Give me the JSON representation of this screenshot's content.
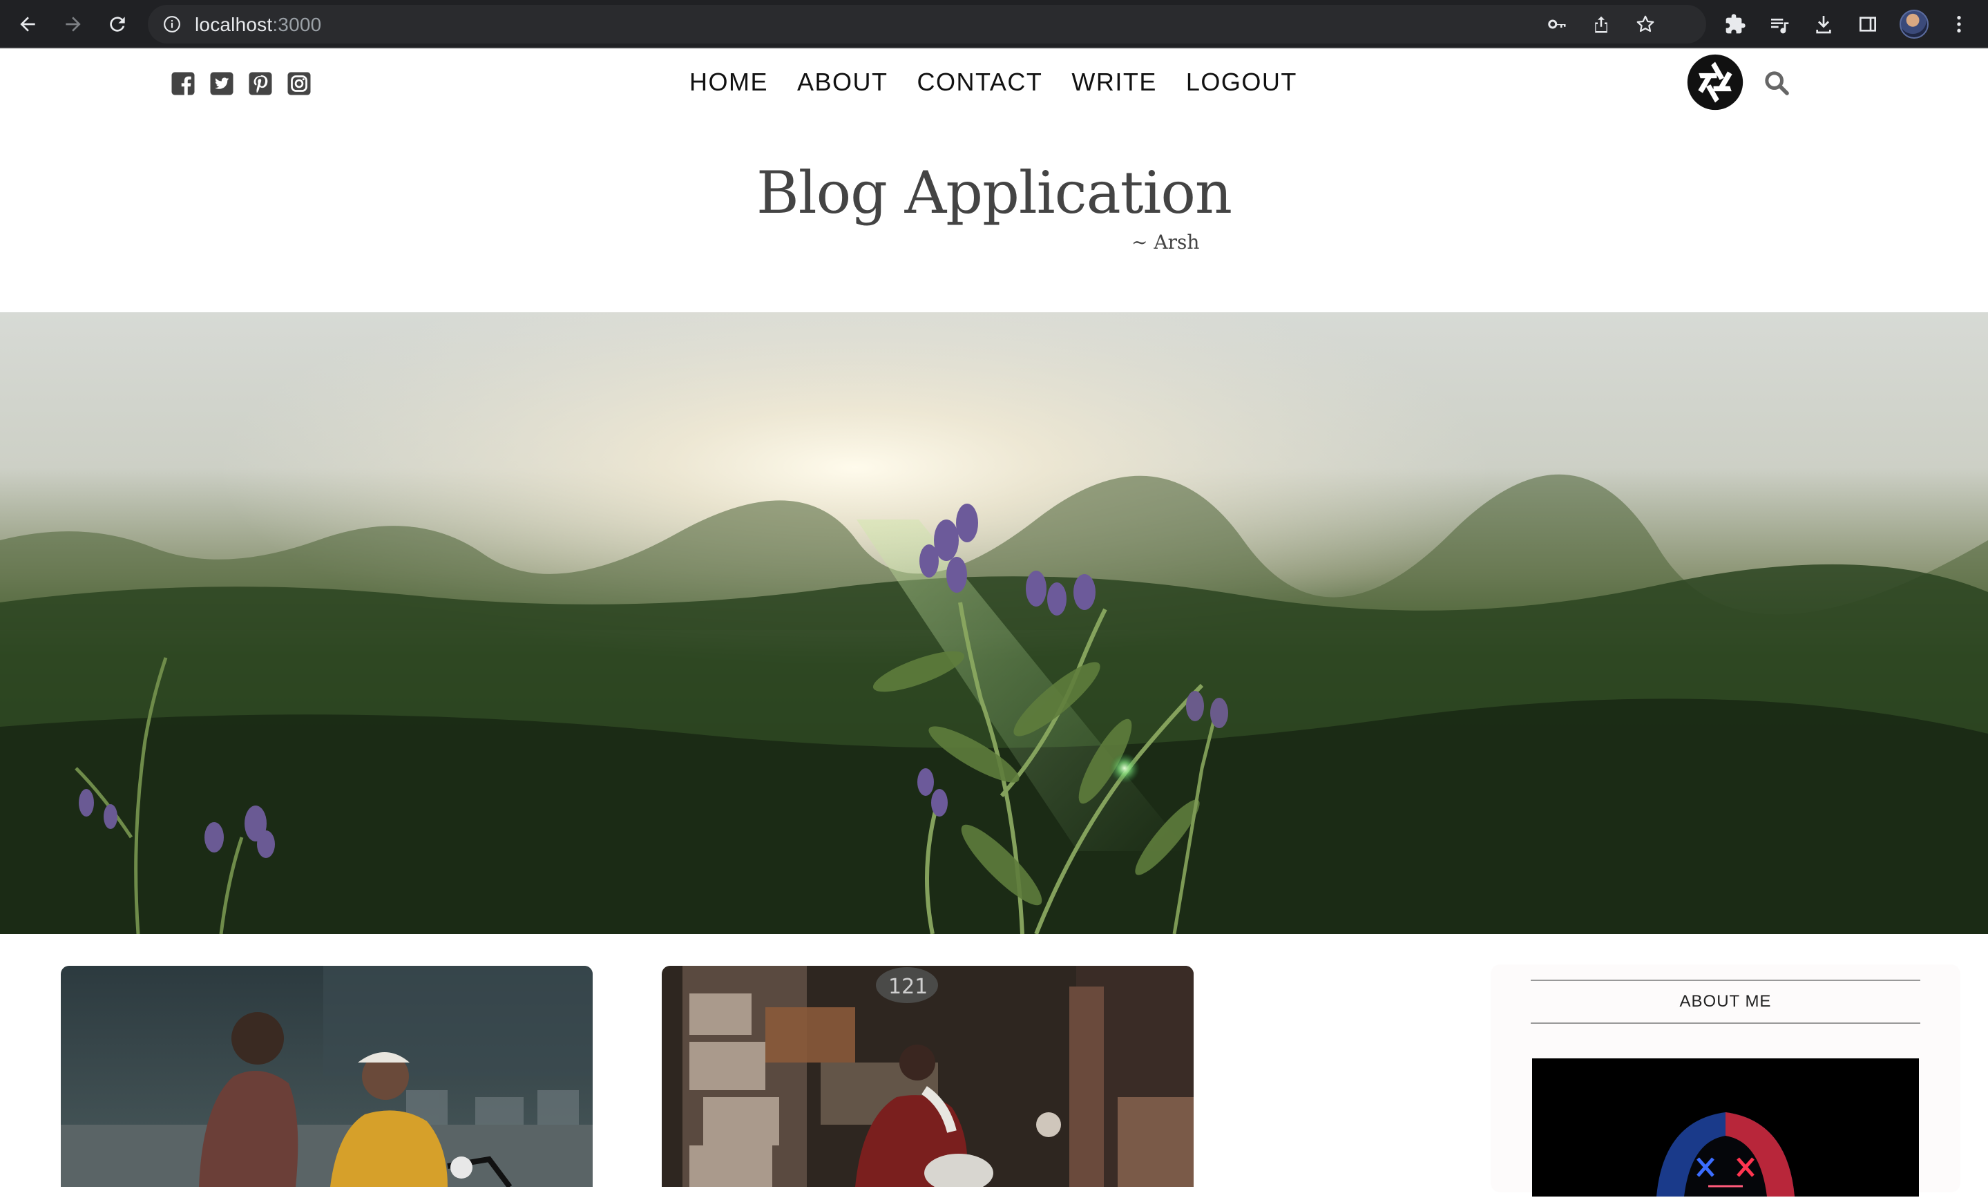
{
  "browser": {
    "url_host": "localhost",
    "url_port": ":3000"
  },
  "site_nav": {
    "social_icons": [
      "facebook-icon",
      "twitter-icon",
      "pinterest-icon",
      "instagram-icon"
    ],
    "menu": [
      "HOME",
      "ABOUT",
      "CONTACT",
      "WRITE",
      "LOGOUT"
    ]
  },
  "header": {
    "title": "Blog Application",
    "subtitle": "~ Arsh"
  },
  "sidebar": {
    "title": "ABOUT ME"
  },
  "colors": {
    "text": "#444444",
    "nav_text": "#111111",
    "chrome_bg": "#202124"
  }
}
